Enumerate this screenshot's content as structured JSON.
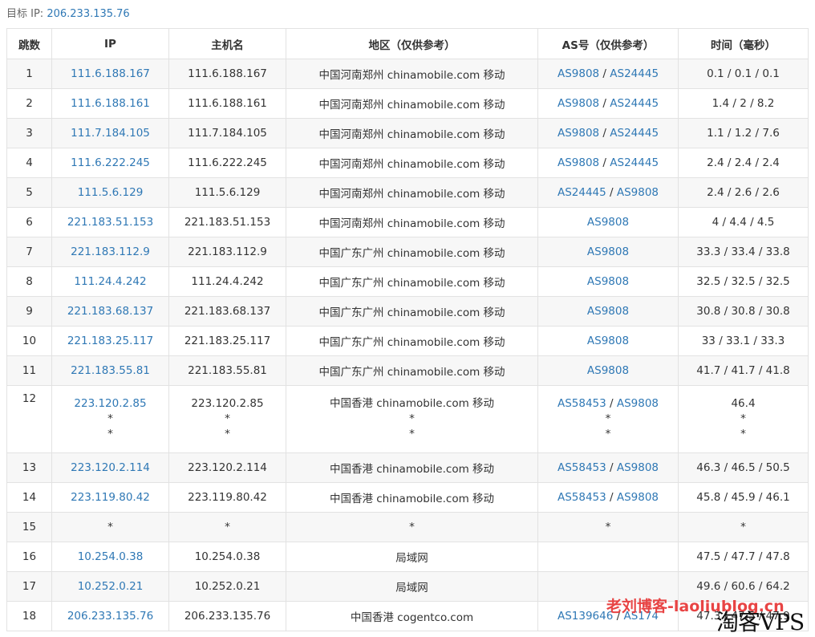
{
  "target": {
    "label": "目标 IP:",
    "ip": "206.233.135.76"
  },
  "columns": [
    "跳数",
    "IP",
    "主机名",
    "地区（仅供参考）",
    "AS号（仅供参考）",
    "时间（毫秒）"
  ],
  "rows": [
    {
      "hop": "1",
      "ip": [
        "111.6.188.167"
      ],
      "host": [
        "111.6.188.167"
      ],
      "region": [
        "中国河南郑州 chinamobile.com 移动"
      ],
      "as": [
        [
          "AS9808",
          "AS24445"
        ]
      ],
      "time": [
        "0.1 / 0.1 / 0.1"
      ]
    },
    {
      "hop": "2",
      "ip": [
        "111.6.188.161"
      ],
      "host": [
        "111.6.188.161"
      ],
      "region": [
        "中国河南郑州 chinamobile.com 移动"
      ],
      "as": [
        [
          "AS9808",
          "AS24445"
        ]
      ],
      "time": [
        "1.4 / 2 / 8.2"
      ]
    },
    {
      "hop": "3",
      "ip": [
        "111.7.184.105"
      ],
      "host": [
        "111.7.184.105"
      ],
      "region": [
        "中国河南郑州 chinamobile.com 移动"
      ],
      "as": [
        [
          "AS9808",
          "AS24445"
        ]
      ],
      "time": [
        "1.1 / 1.2 / 7.6"
      ]
    },
    {
      "hop": "4",
      "ip": [
        "111.6.222.245"
      ],
      "host": [
        "111.6.222.245"
      ],
      "region": [
        "中国河南郑州 chinamobile.com 移动"
      ],
      "as": [
        [
          "AS9808",
          "AS24445"
        ]
      ],
      "time": [
        "2.4 / 2.4 / 2.4"
      ]
    },
    {
      "hop": "5",
      "ip": [
        "111.5.6.129"
      ],
      "host": [
        "111.5.6.129"
      ],
      "region": [
        "中国河南郑州 chinamobile.com 移动"
      ],
      "as": [
        [
          "AS24445",
          "AS9808"
        ]
      ],
      "time": [
        "2.4 / 2.6 / 2.6"
      ]
    },
    {
      "hop": "6",
      "ip": [
        "221.183.51.153"
      ],
      "host": [
        "221.183.51.153"
      ],
      "region": [
        "中国河南郑州 chinamobile.com 移动"
      ],
      "as": [
        [
          "AS9808"
        ]
      ],
      "time": [
        "4 / 4.4 / 4.5"
      ]
    },
    {
      "hop": "7",
      "ip": [
        "221.183.112.9"
      ],
      "host": [
        "221.183.112.9"
      ],
      "region": [
        "中国广东广州 chinamobile.com 移动"
      ],
      "as": [
        [
          "AS9808"
        ]
      ],
      "time": [
        "33.3 / 33.4 / 33.8"
      ]
    },
    {
      "hop": "8",
      "ip": [
        "111.24.4.242"
      ],
      "host": [
        "111.24.4.242"
      ],
      "region": [
        "中国广东广州 chinamobile.com 移动"
      ],
      "as": [
        [
          "AS9808"
        ]
      ],
      "time": [
        "32.5 / 32.5 / 32.5"
      ]
    },
    {
      "hop": "9",
      "ip": [
        "221.183.68.137"
      ],
      "host": [
        "221.183.68.137"
      ],
      "region": [
        "中国广东广州 chinamobile.com 移动"
      ],
      "as": [
        [
          "AS9808"
        ]
      ],
      "time": [
        "30.8 / 30.8 / 30.8"
      ]
    },
    {
      "hop": "10",
      "ip": [
        "221.183.25.117"
      ],
      "host": [
        "221.183.25.117"
      ],
      "region": [
        "中国广东广州 chinamobile.com 移动"
      ],
      "as": [
        [
          "AS9808"
        ]
      ],
      "time": [
        "33 / 33.1 / 33.3"
      ]
    },
    {
      "hop": "11",
      "ip": [
        "221.183.55.81"
      ],
      "host": [
        "221.183.55.81"
      ],
      "region": [
        "中国广东广州 chinamobile.com 移动"
      ],
      "as": [
        [
          "AS9808"
        ]
      ],
      "time": [
        "41.7 / 41.7 / 41.8"
      ]
    },
    {
      "hop": "12",
      "ip": [
        "223.120.2.85",
        "*",
        "*"
      ],
      "host": [
        "223.120.2.85",
        "*",
        "*"
      ],
      "region": [
        "中国香港 chinamobile.com 移动",
        "*",
        "*"
      ],
      "as": [
        [
          "AS58453",
          "AS9808"
        ],
        [
          "*"
        ],
        [
          "*"
        ]
      ],
      "time": [
        "46.4",
        "*",
        "*"
      ]
    },
    {
      "hop": "13",
      "ip": [
        "223.120.2.114"
      ],
      "host": [
        "223.120.2.114"
      ],
      "region": [
        "中国香港 chinamobile.com 移动"
      ],
      "as": [
        [
          "AS58453",
          "AS9808"
        ]
      ],
      "time": [
        "46.3 / 46.5 / 50.5"
      ]
    },
    {
      "hop": "14",
      "ip": [
        "223.119.80.42"
      ],
      "host": [
        "223.119.80.42"
      ],
      "region": [
        "中国香港 chinamobile.com 移动"
      ],
      "as": [
        [
          "AS58453",
          "AS9808"
        ]
      ],
      "time": [
        "45.8 / 45.9 / 46.1"
      ]
    },
    {
      "hop": "15",
      "ip": [
        "*"
      ],
      "host": [
        "*"
      ],
      "region": [
        "*"
      ],
      "as": [
        [
          "*"
        ]
      ],
      "time": [
        "*"
      ]
    },
    {
      "hop": "16",
      "ip": [
        "10.254.0.38"
      ],
      "host": [
        "10.254.0.38"
      ],
      "region": [
        "局域网"
      ],
      "as": [
        []
      ],
      "time": [
        "47.5 / 47.7 / 47.8"
      ]
    },
    {
      "hop": "17",
      "ip": [
        "10.252.0.21"
      ],
      "host": [
        "10.252.0.21"
      ],
      "region": [
        "局域网"
      ],
      "as": [
        []
      ],
      "time": [
        "49.6 / 60.6 / 64.2"
      ]
    },
    {
      "hop": "18",
      "ip": [
        "206.233.135.76"
      ],
      "host": [
        "206.233.135.76"
      ],
      "region": [
        "中国香港 cogentco.com"
      ],
      "as": [
        [
          "AS139646",
          "AS174"
        ]
      ],
      "time": [
        "47.3 / 47.5 / 47.9"
      ]
    }
  ],
  "watermarks": [
    "老刘博客-laoliublog.cn",
    "淘客VPS"
  ],
  "colors": {
    "link": "#2f78b5",
    "stripe": "#f7f7f7",
    "border": "#e2e2e2",
    "watermark_red": "#e73a3a"
  }
}
